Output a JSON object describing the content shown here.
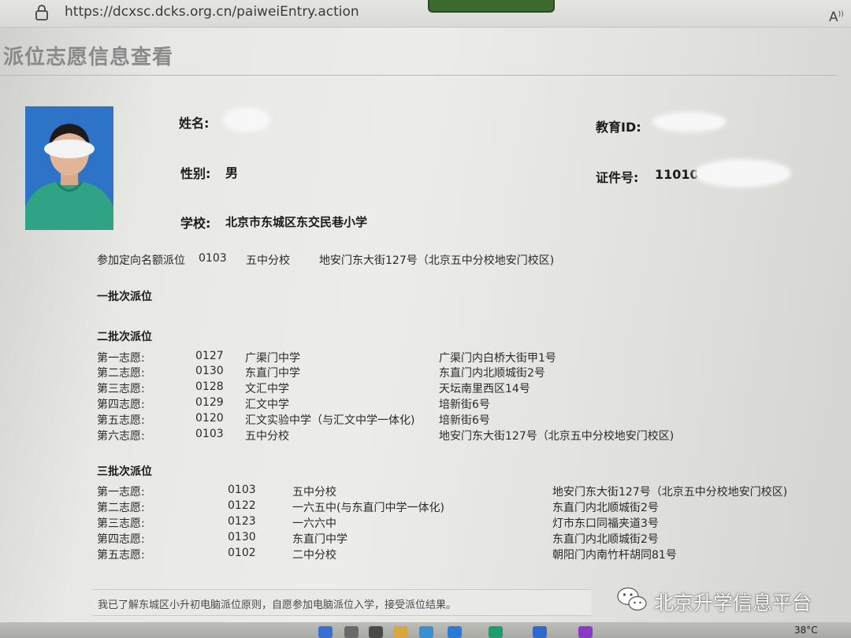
{
  "browser": {
    "url": "https://dcxsc.dcks.org.cn/paiweiEntry.action"
  },
  "page": {
    "title": "派位志愿信息查看"
  },
  "student": {
    "name_label": "姓名:",
    "edu_id_label": "教育ID:",
    "gender_label": "性别:",
    "gender_value": "男",
    "id_label": "证件号:",
    "id_value": "11010",
    "school_label": "学校:",
    "school_value": "北京市东城区东交民巷小学"
  },
  "directed": {
    "label": "参加定向名额派位",
    "code": "0103",
    "school": "五中分校",
    "address": "地安门东大街127号（北京五中分校地安门校区)"
  },
  "batch1": {
    "title": "一批次派位"
  },
  "batch2": {
    "title": "二批次派位",
    "rows": [
      {
        "order": "第一志愿:",
        "code": "0127",
        "school": "广渠门中学",
        "address": "广渠门内白桥大街甲1号"
      },
      {
        "order": "第二志愿:",
        "code": "0130",
        "school": "东直门中学",
        "address": "东直门内北顺城街2号"
      },
      {
        "order": "第三志愿:",
        "code": "0128",
        "school": "文汇中学",
        "address": "天坛南里西区14号"
      },
      {
        "order": "第四志愿:",
        "code": "0129",
        "school": "汇文中学",
        "address": "培新街6号"
      },
      {
        "order": "第五志愿:",
        "code": "0120",
        "school": "汇文实验中学（与汇文中学一体化)",
        "address": "培新街6号"
      },
      {
        "order": "第六志愿:",
        "code": "0103",
        "school": "五中分校",
        "address": "地安门东大街127号（北京五中分校地安门校区)"
      }
    ]
  },
  "batch3": {
    "title": "三批次派位",
    "rows": [
      {
        "order": "第一志愿:",
        "code": "0103",
        "school": "五中分校",
        "address": "地安门东大街127号（北京五中分校地安门校区)"
      },
      {
        "order": "第二志愿:",
        "code": "0122",
        "school": "一六五中(与东直门中学一体化)",
        "address": "东直门内北顺城街2号"
      },
      {
        "order": "第三志愿:",
        "code": "0123",
        "school": "一六六中",
        "address": "灯市东口同福夹道3号"
      },
      {
        "order": "第四志愿:",
        "code": "0130",
        "school": "东直门中学",
        "address": "东直门内北顺城街2号"
      },
      {
        "order": "第五志愿:",
        "code": "0102",
        "school": "二中分校",
        "address": "朝阳门内南竹杆胡同81号"
      }
    ]
  },
  "agreement": {
    "text": "我已了解东城区小升初电脑派位原则，自愿参加电脑派位入学，接受派位结果。"
  },
  "watermark": {
    "text": "北京升学信息平台"
  },
  "taskbar": {
    "temperature": "38°C"
  }
}
